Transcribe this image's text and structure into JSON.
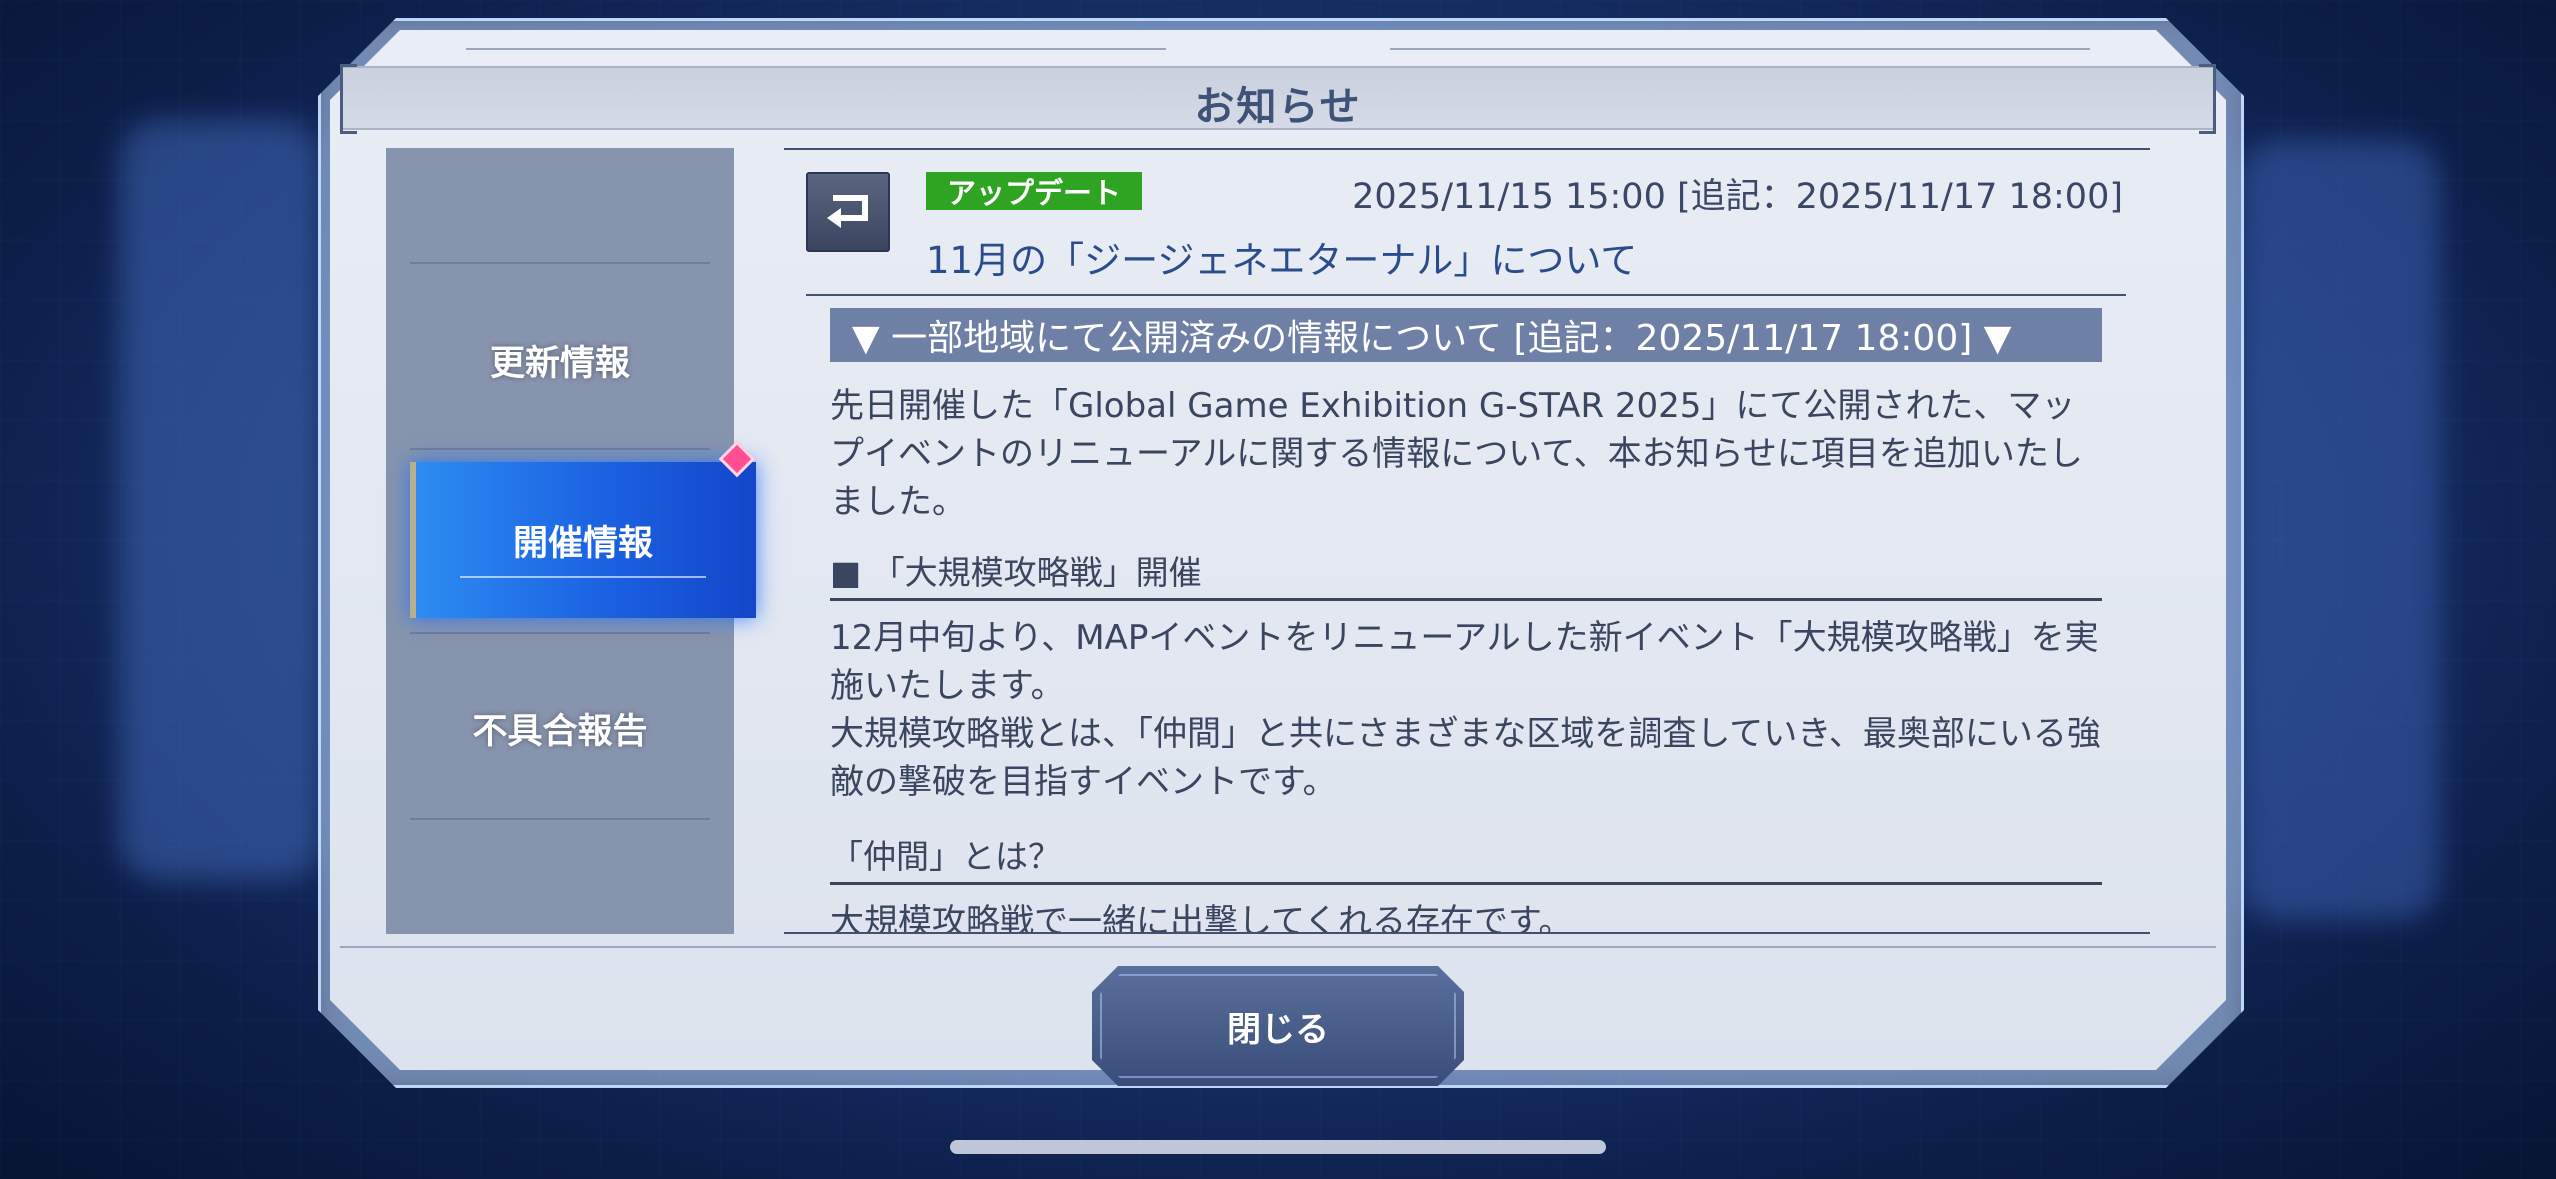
{
  "dialog": {
    "title": "お知らせ",
    "close_label": "閉じる"
  },
  "sidebar": {
    "items": [
      {
        "label": "更新情報",
        "active": false
      },
      {
        "label": "開催情報",
        "active": true
      },
      {
        "label": "不具合報告",
        "active": false
      }
    ]
  },
  "notice": {
    "tag": "アップデート",
    "tag_color": "#2fa322",
    "date": "2025/11/15 15:00 [追記：2025/11/17 18:00]",
    "title": "11月の「ジージェネエターナル」について",
    "back_icon": "return-arrow-icon",
    "section_heading": "▼ 一部地域にて公開済みの情報について [追記：2025/11/17 18:00] ▼",
    "intro": "先日開催した「Global Game Exhibition G-STAR 2025」にて公開された、マップイベントのリニューアルに関する情報について、本お知らせに項目を追加いたしました。",
    "sub1": "■ 「大規模攻略戦」開催",
    "body1": "12月中旬より、MAPイベントをリニューアルした新イベント「大規模攻略戦」を実施いたします。",
    "body2": "大規模攻略戦とは、「仲間」と共にさまざまな区域を調査していき、最奥部にいる強敵の撃破を目指すイベントです。",
    "sub2": "「仲間」とは？",
    "body3": "大規模攻略戦で一緒に出撃してくれる存在です。"
  },
  "colors": {
    "active_tab": "#1a5fe0",
    "accent_pink": "#ff4f92",
    "title_blue": "#2b4c8c"
  }
}
